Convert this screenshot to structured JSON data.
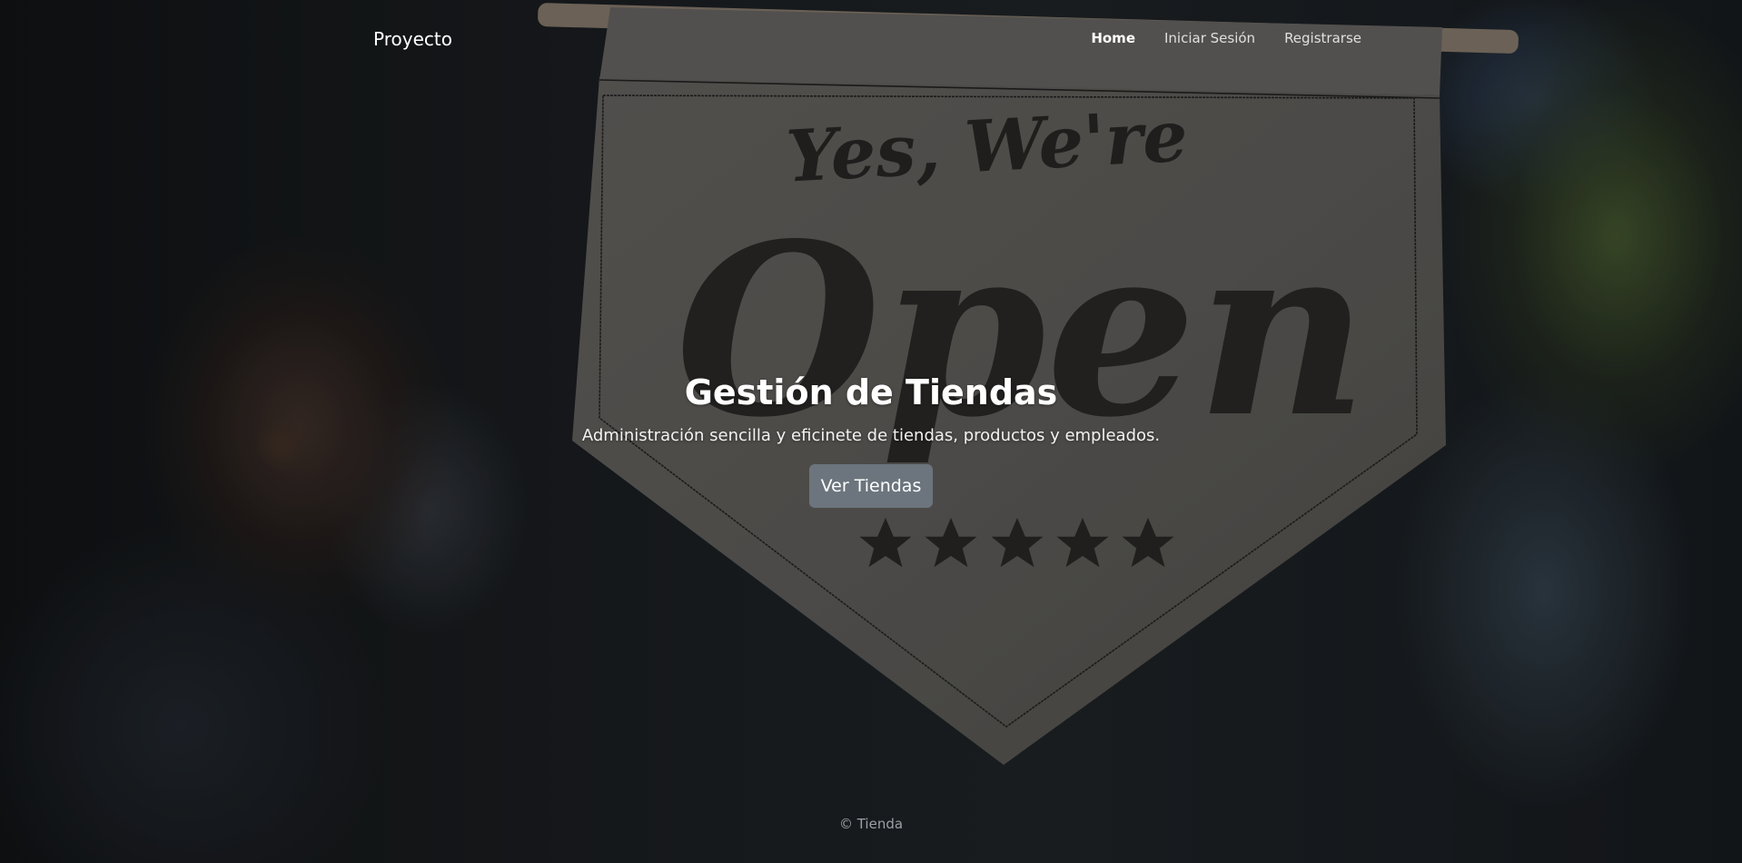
{
  "navbar": {
    "brand": "Proyecto",
    "links": [
      {
        "label": "Home",
        "active": true
      },
      {
        "label": "Iniciar Sesión",
        "active": false
      },
      {
        "label": "Registrarse",
        "active": false
      }
    ]
  },
  "hero": {
    "title": "Gestión de Tiendas",
    "subtitle": "Administración sencilla y eficinete de tiendas, productos y empleados.",
    "button_label": "Ver Tiendas",
    "button_color": "#6c757d",
    "background_image": {
      "sign_top_text": "Yes, We're",
      "sign_main_text": "Open",
      "stars": 5
    }
  },
  "footer": {
    "text": "© Tienda"
  }
}
